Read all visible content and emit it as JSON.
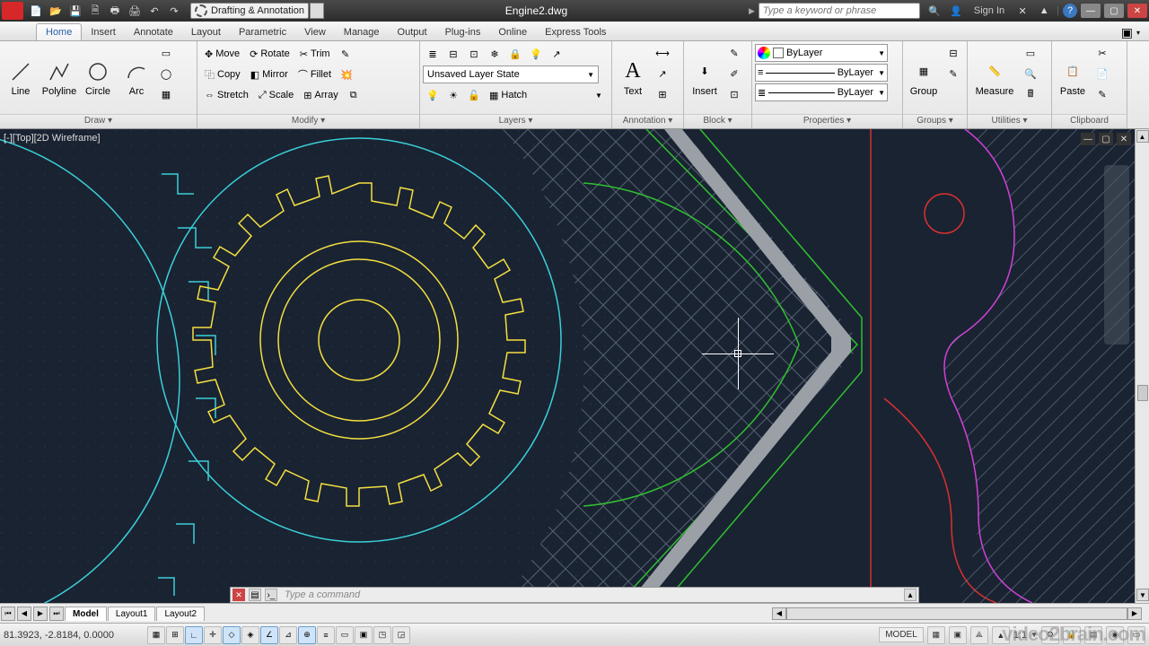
{
  "title": "Engine2.dwg",
  "workspace": "Drafting & Annotation",
  "search_placeholder": "Type a keyword or phrase",
  "signin": "Sign In",
  "tabs": {
    "home": "Home",
    "insert": "Insert",
    "annotate": "Annotate",
    "layout": "Layout",
    "parametric": "Parametric",
    "view": "View",
    "manage": "Manage",
    "output": "Output",
    "plugins": "Plug-ins",
    "online": "Online",
    "express": "Express Tools"
  },
  "ribbon": {
    "draw": {
      "title": "Draw ▾",
      "line": "Line",
      "polyline": "Polyline",
      "circle": "Circle",
      "arc": "Arc"
    },
    "modify": {
      "title": "Modify ▾",
      "move": "Move",
      "rotate": "Rotate",
      "trim": "Trim",
      "copy": "Copy",
      "mirror": "Mirror",
      "fillet": "Fillet",
      "stretch": "Stretch",
      "scale": "Scale",
      "array": "Array"
    },
    "layers": {
      "title": "Layers ▾",
      "state": "Unsaved Layer State",
      "hatch": "Hatch"
    },
    "annotation": {
      "title": "Annotation ▾",
      "text": "Text"
    },
    "block": {
      "title": "Block ▾",
      "insert": "Insert"
    },
    "properties": {
      "title": "Properties ▾",
      "color": "ByLayer",
      "lw": "ByLayer",
      "lt": "ByLayer"
    },
    "groups": {
      "title": "Groups ▾",
      "group": "Group"
    },
    "utilities": {
      "title": "Utilities ▾",
      "measure": "Measure"
    },
    "clipboard": {
      "title": "Clipboard",
      "paste": "Paste"
    }
  },
  "viewport_label": "[-][Top][2D Wireframe]",
  "command_placeholder": "Type a command",
  "layout_tabs": {
    "model": "Model",
    "l1": "Layout1",
    "l2": "Layout2"
  },
  "status": {
    "coords": "81.3923, -2.8184, 0.0000",
    "model": "MODEL",
    "scale": "1:1"
  },
  "watermark": "video2brain.com"
}
